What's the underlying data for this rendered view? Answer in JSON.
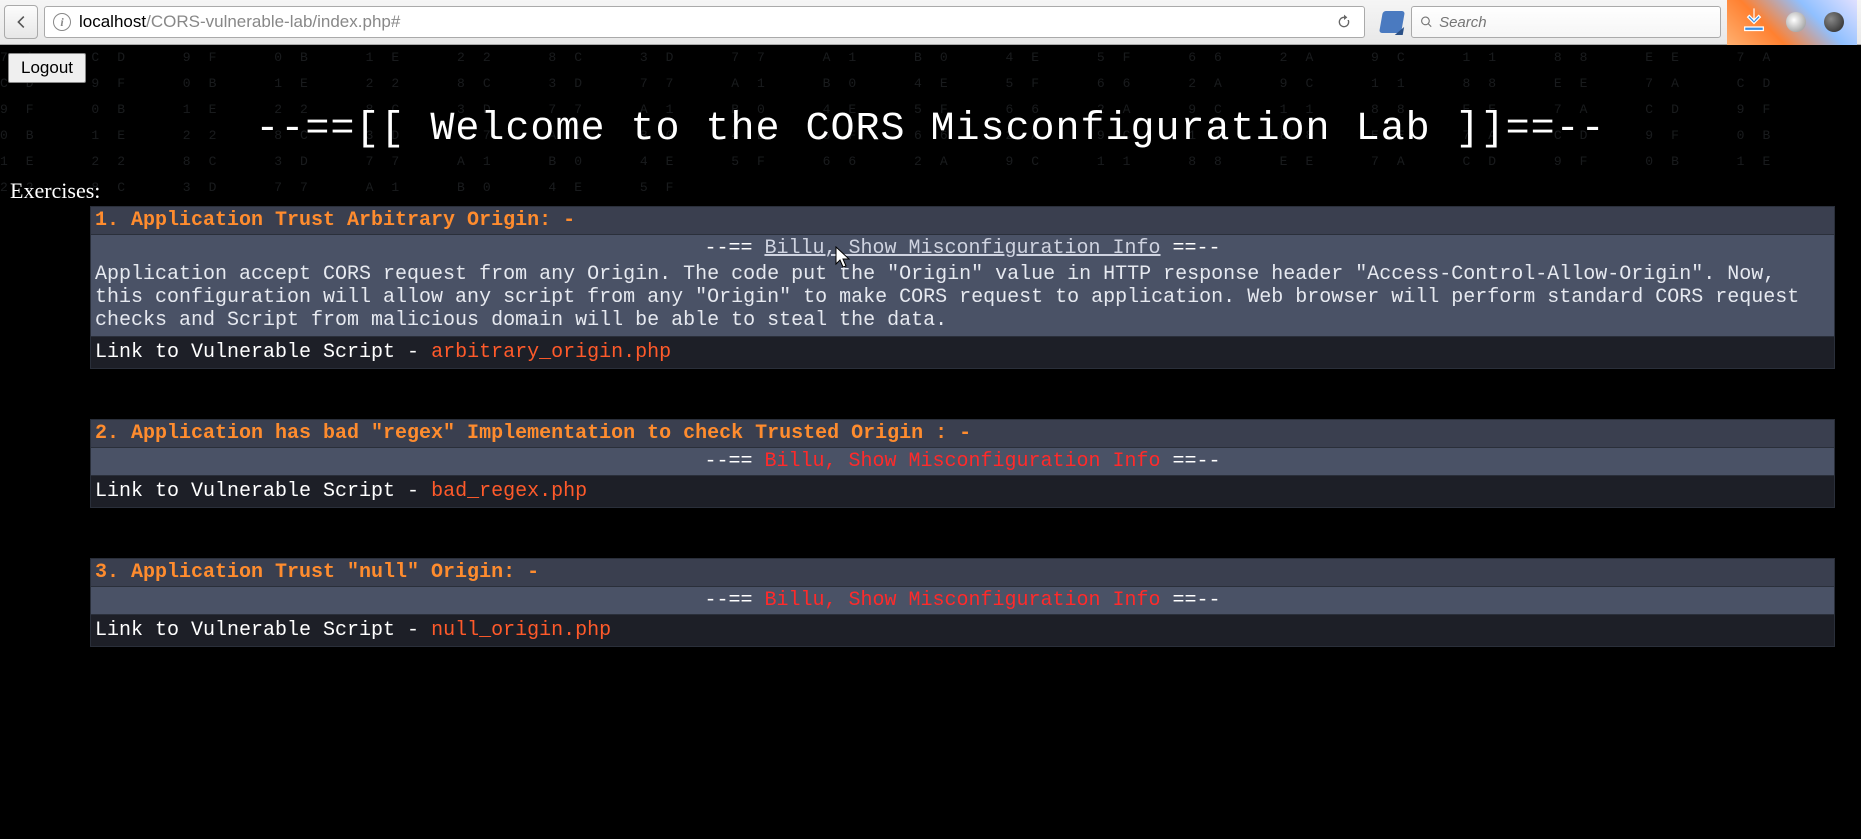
{
  "browser": {
    "url_host": "localhost",
    "url_path": "/CORS-vulnerable-lab/index.php#",
    "search_placeholder": "Search"
  },
  "page": {
    "logout_label": "Logout",
    "title": "--==[[ Welcome to the CORS Misconfiguration Lab ]]==--",
    "exercises_label": "Exercises:",
    "toggle_prefix": "--== ",
    "toggle_suffix": " ==--",
    "toggle_text": "Billu, Show Misconfiguration Info",
    "link_prefix": "Link to Vulnerable Script - "
  },
  "exercises": [
    {
      "header": "1. Application Trust Arbitrary Origin: -",
      "expanded": true,
      "desc": "Application accept CORS request from any Origin. The code put the \"Origin\" value in HTTP response header \"Access-Control-Allow-Origin\". Now, this configuration will allow any script from any \"Origin\" to make CORS request to application. Web browser will perform standard CORS request checks and Script from malicious domain will be able to steal the data.",
      "script": "arbitrary_origin.php"
    },
    {
      "header": "2. Application has bad \"regex\" Implementation to check Trusted Origin : -",
      "expanded": false,
      "desc": "",
      "script": "bad_regex.php"
    },
    {
      "header": "3. Application Trust \"null\" Origin: -",
      "expanded": false,
      "desc": "",
      "script": "null_origin.php"
    }
  ]
}
